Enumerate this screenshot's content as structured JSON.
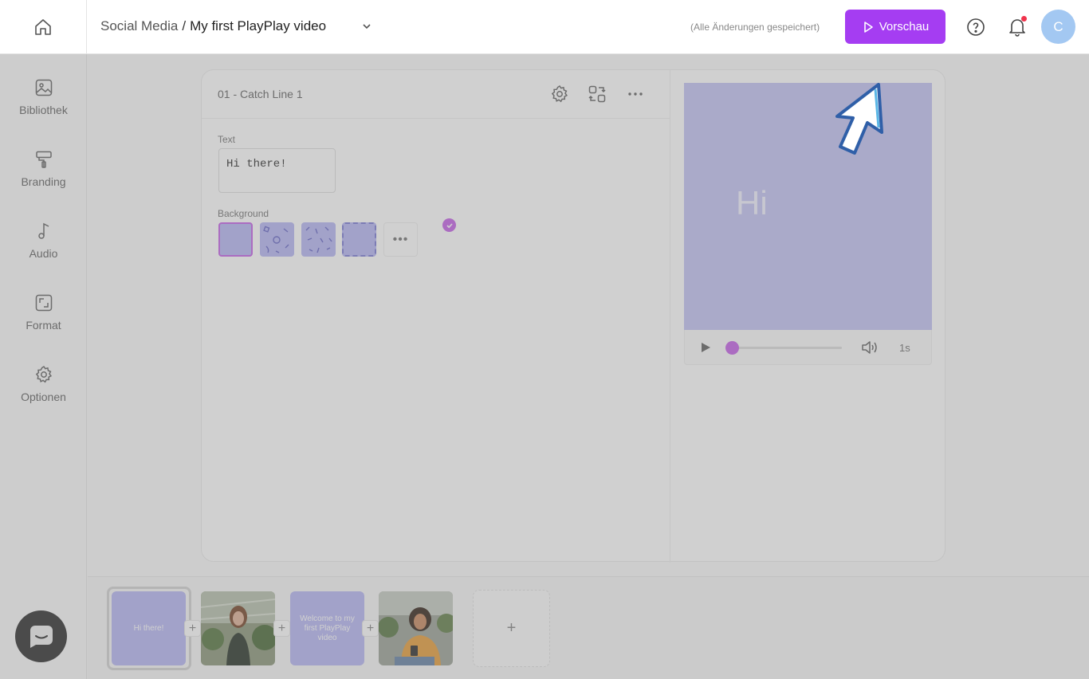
{
  "header": {
    "breadcrumb_root": "Social Media",
    "breadcrumb_separator": "/",
    "project_name": "My first PlayPlay video",
    "save_status": "(Alle Änderungen gespeichert)",
    "preview_label": "Vorschau",
    "avatar_initial": "C"
  },
  "sidebar": {
    "items": [
      {
        "label": "Bibliothek",
        "icon": "image-icon"
      },
      {
        "label": "Branding",
        "icon": "paint-roller-icon"
      },
      {
        "label": "Audio",
        "icon": "music-note-icon"
      },
      {
        "label": "Format",
        "icon": "resize-icon"
      },
      {
        "label": "Optionen",
        "icon": "gear-icon"
      }
    ]
  },
  "editor": {
    "scene_title": "01 - Catch Line 1",
    "text_label": "Text",
    "text_value": "Hi there!",
    "background_label": "Background",
    "more_label": "•••"
  },
  "preview": {
    "text": "Hi",
    "duration": "1s",
    "background_color": "#c5c5f5"
  },
  "timeline": {
    "scenes": [
      {
        "type": "text",
        "text": "Hi there!"
      },
      {
        "type": "photo",
        "subject": "woman-in-greenhouse"
      },
      {
        "type": "text",
        "text": "Welcome to my first PlayPlay video"
      },
      {
        "type": "photo",
        "subject": "woman-with-phone"
      }
    ],
    "plus_label": "+",
    "add_label": "+"
  },
  "colors": {
    "accent": "#a53df2",
    "selection": "#c766e8",
    "lavender": "#b9b9f5"
  }
}
